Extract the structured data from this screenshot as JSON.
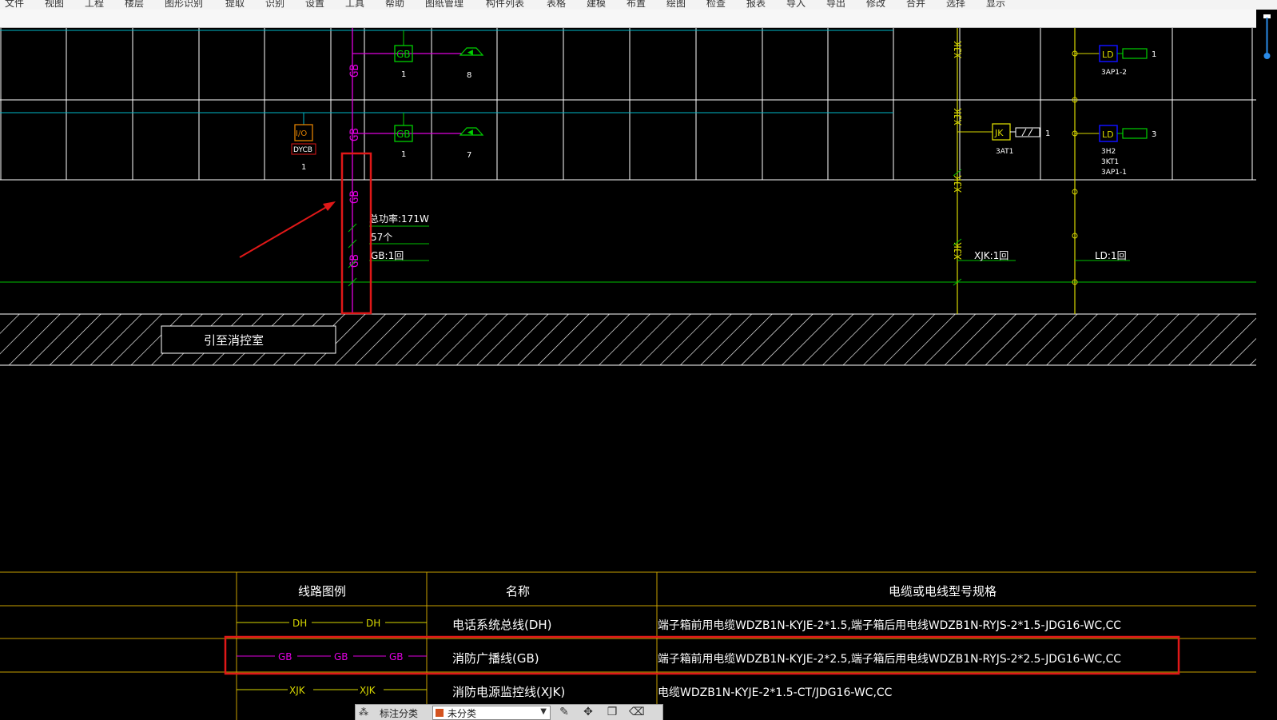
{
  "menu": {
    "items": [
      "文件",
      "视图",
      "工程",
      "楼层",
      "图形识别",
      "提取",
      "识别",
      "设置",
      "工具",
      "帮助",
      "图纸管理",
      "构件列表",
      "表格",
      "建模",
      "布置",
      "绘图",
      "检查",
      "报表",
      "导入",
      "导出",
      "修改",
      "合并",
      "选择",
      "显示"
    ]
  },
  "drawing": {
    "left_labels": {
      "gb_box1": "GB",
      "gb_box1_count": "1",
      "speaker1_count": "8",
      "gb_box2": "GB",
      "gb_box2_count": "1",
      "speaker2_count": "7",
      "io_box": "I/O",
      "io_tag": "DYCB",
      "io_count": "1",
      "vertical_tag": "GB",
      "power_note": "总功率:171W",
      "count_note": "57个",
      "circuit_note": "GB:1回",
      "bottom_box_text": "引至消控室"
    },
    "right_labels": {
      "xjk_tag": "XJK",
      "jk_box": "JK",
      "jk_count": "1",
      "jk_tag": "3AT1",
      "ld_box1": "LD",
      "ld1_count": "1",
      "ld1_tag": "3AP1-2",
      "ld_box2": "LD",
      "ld2_count": "3",
      "ld2_tags": [
        "3H2",
        "3KT1",
        "3AP1-1"
      ],
      "xjk_circuit": "XJK:1回",
      "ld_circuit": "LD:1回"
    },
    "legend": {
      "headers": [
        "线路图例",
        "名称",
        "电缆或电线型号规格"
      ],
      "rows": [
        {
          "symbols": [
            "DH",
            "DH"
          ],
          "name": "电话系统总线(DH)",
          "spec": "端子箱前用电缆WDZB1N-KYJE-2*1.5,端子箱后用电线WDZB1N-RYJS-2*1.5-JDG16-WC,CC"
        },
        {
          "symbols": [
            "GB",
            "GB",
            "GB"
          ],
          "name": "消防广播线(GB)",
          "spec": "端子箱前用电缆WDZB1N-KYJE-2*2.5,端子箱后用电线WDZB1N-RYJS-2*2.5-JDG16-WC,CC"
        },
        {
          "symbols": [
            "XJK",
            "XJK"
          ],
          "name": "消防电源监控线(XJK)",
          "spec": "电缆WDZB1N-KYJE-2*1.5-CT/JDG16-WC,CC"
        }
      ]
    }
  },
  "toolbar": {
    "label": "标注分类",
    "category": "未分类"
  },
  "colors": {
    "gb": "#e000e0",
    "line_green": "#00c000",
    "box_green": "#00d000",
    "cyan": "#00b8c8",
    "yellow": "#d8d800",
    "legend_gold": "#c8a000",
    "orange": "#e08000",
    "blue": "#1010ff",
    "red_highlight": "#e01818",
    "grid_white": "#ffffff"
  }
}
